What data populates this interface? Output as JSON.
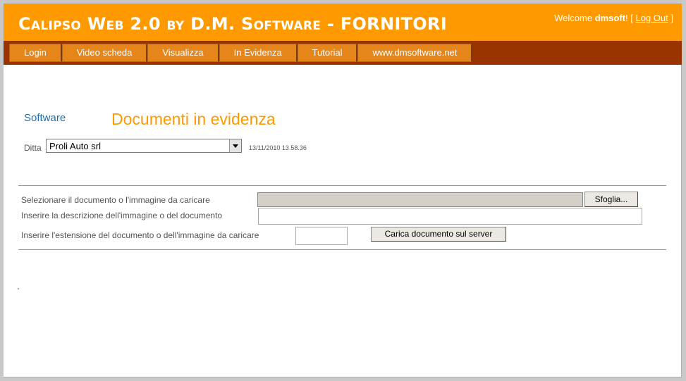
{
  "header": {
    "title": "Calipso Web 2.0 by D.M. Software - FORNITORI",
    "welcome_prefix": "Welcome ",
    "username": "dmsoft",
    "welcome_suffix": "! [ ",
    "logout_label": "Log Out",
    "bracket_close": " ]"
  },
  "menu": {
    "items": [
      "Login",
      "Video scheda",
      "Visualizza",
      "In Evidenza",
      "Tutorial",
      "www.dmsoftware.net"
    ]
  },
  "section": {
    "software_label": "Software",
    "title": "Documenti in evidenza",
    "ditta_label": "Ditta",
    "ditta_value": "Proli Auto srl",
    "timestamp": "13/11/2010 13.58.36"
  },
  "upload_form": {
    "file_label": "Selezionare il documento o l'immagine da caricare",
    "browse_label": "Sfoglia...",
    "description_label": "Inserire la descrizione dell'immagine o del documento",
    "description_value": "",
    "extension_label": "Inserire l'estensione del documento o dell'immagine da caricare",
    "extension_value": "",
    "upload_button_label": "Carica documento sul server"
  },
  "colors": {
    "header_bg": "#ff9900",
    "menubar_bg": "#993300",
    "menu_item_bg": "#e6861a",
    "title_accent": "#ff9900",
    "link_blue": "#1f6fa8"
  }
}
